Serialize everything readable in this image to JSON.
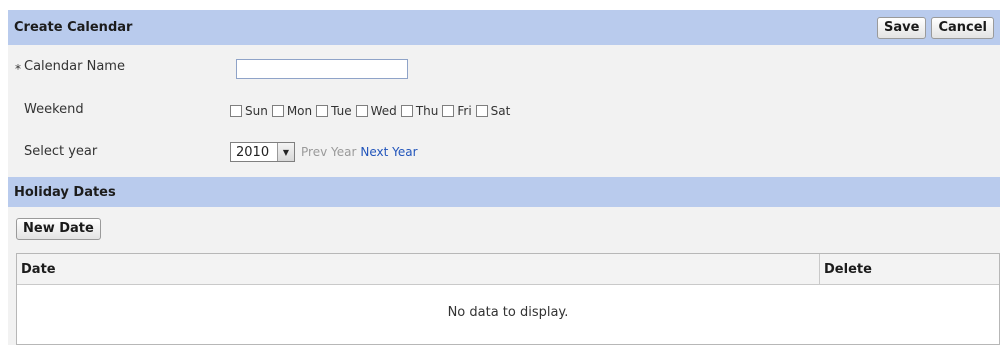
{
  "header": {
    "title": "Create Calendar",
    "save_label": "Save",
    "cancel_label": "Cancel"
  },
  "form": {
    "required_marker": "*",
    "calendar_name_label": "Calendar Name",
    "calendar_name_value": "",
    "weekend_label": "Weekend",
    "weekend_days": [
      {
        "label": "Sun",
        "checked": false
      },
      {
        "label": "Mon",
        "checked": false
      },
      {
        "label": "Tue",
        "checked": false
      },
      {
        "label": "Wed",
        "checked": false
      },
      {
        "label": "Thu",
        "checked": false
      },
      {
        "label": "Fri",
        "checked": false
      },
      {
        "label": "Sat",
        "checked": false
      }
    ],
    "select_year_label": "Select year",
    "selected_year": "2010",
    "prev_year_label": "Prev Year",
    "next_year_label": "Next Year"
  },
  "holidays": {
    "section_title": "Holiday Dates",
    "new_date_label": "New Date",
    "columns": {
      "date": "Date",
      "delete": "Delete"
    },
    "empty_message": "No data to display."
  },
  "icons": {
    "select_arrow": "dropdown-arrow-icon"
  },
  "colors": {
    "header_bg": "#b9cbed",
    "link": "#2255bb",
    "disabled_link": "#9a9a9a"
  }
}
